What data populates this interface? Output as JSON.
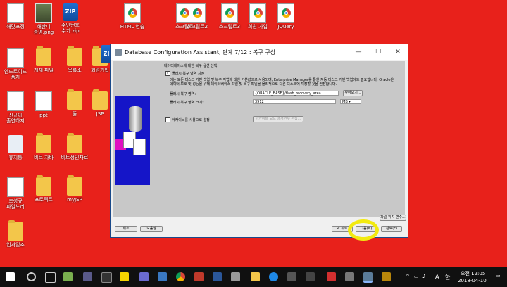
{
  "desktop_icons": [
    {
      "label": "해맞포징",
      "kind": "doc"
    },
    {
      "label": "해봔디\n증명.png",
      "kind": "photo"
    },
    {
      "label": "주민번호\n수가.zip",
      "kind": "zip"
    },
    {
      "label": "HTML 연습",
      "kind": "chrome"
    },
    {
      "label": "스크립트",
      "kind": "chrome"
    },
    {
      "label": "스크립트2",
      "kind": "chrome"
    },
    {
      "label": "스크립트3",
      "kind": "chrome"
    },
    {
      "label": "회원 가입",
      "kind": "chrome"
    },
    {
      "label": "JQuery",
      "kind": "chrome"
    },
    {
      "label": "안드로이드\n품자",
      "kind": "doc"
    },
    {
      "label": "개체 파일",
      "kind": "folder"
    },
    {
      "label": "목록소",
      "kind": "folder"
    },
    {
      "label": "회원가입",
      "kind": "folder"
    },
    {
      "label": "신규아\n출연하지",
      "kind": "doc"
    },
    {
      "label": "ppt",
      "kind": "doc"
    },
    {
      "label": "뚫",
      "kind": "folder"
    },
    {
      "label": "JSP",
      "kind": "folder"
    },
    {
      "label": "휴지통",
      "kind": "recycle"
    },
    {
      "label": "비트 자바",
      "kind": "folder"
    },
    {
      "label": "비트정인자료",
      "kind": "folder"
    },
    {
      "label": "조성규\n파일노리",
      "kind": "doc"
    },
    {
      "label": "프로젝트",
      "kind": "folder"
    },
    {
      "label": "myJSP",
      "kind": "folder"
    },
    {
      "label": "임과일조",
      "kind": "folder"
    }
  ],
  "window": {
    "title": "Database Configuration Assistant, 단계 7/12 : 복구 구성",
    "zip_badge": "ZIP",
    "minimize": "—",
    "maximize": "☐",
    "close": "✕",
    "heading": "데이터베이스에 대한 복구 옵션 선택:",
    "flash_checkbox": "플래시 복구 영역 지정",
    "description": "이는 모든 디스크 기반 백업 및 복구 작업에 대한 기본값으로 사용되며, Enterprise Manager를 통한 자동 디스크 기반 백업에도 필요합니다. Oracle은 데이터 보호 및 성능을 위해 데이터베이스 파일 및 복구 파일을 물리적으로 다른 디스크에 저장할 것을 권장합니다.",
    "area_label": "플래시 복구 영역:",
    "area_value": "{ORACLE_BASE}/flash_recovery_area",
    "browse": "찾아보기...",
    "size_label": "플래시 복구 영역 크기:",
    "size_value": "3912",
    "size_unit": "MB",
    "archive_checkbox": "아카이브를 사용으로 설정",
    "archive_button": "아카이브 모드 매개변수 편집...",
    "file_location_vars": "파일 위치 변수...",
    "cancel": "취소",
    "help": "도움말",
    "back": "< 뒤로",
    "next": "다음(N)",
    "finish": "완료(F)"
  },
  "taskbar": {
    "lang": "A",
    "ime": "한",
    "time": "오전 12:05",
    "date": "2018-04-10"
  }
}
